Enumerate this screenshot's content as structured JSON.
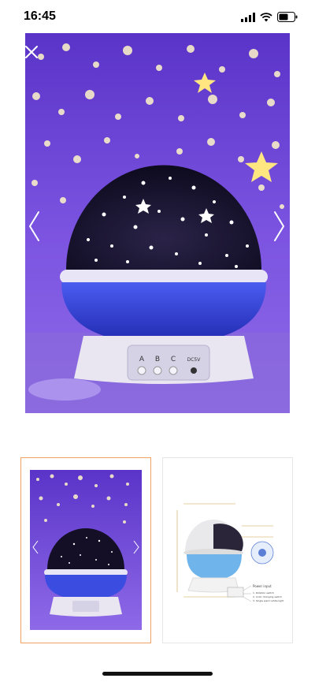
{
  "status_bar": {
    "time": "16:45",
    "icons": [
      "cellular-signal-icon",
      "wifi-icon",
      "battery-icon"
    ]
  },
  "viewer": {
    "close_icon": "close-icon",
    "prev_icon": "chevron-left-icon",
    "next_icon": "chevron-right-icon",
    "product_button_labels": [
      "A",
      "B",
      "C",
      "DC5V"
    ]
  },
  "thumbnails": [
    {
      "name": "starry-projector-photo",
      "selected": true
    },
    {
      "name": "projector-diagram",
      "selected": false,
      "annotations": [
        "Power input",
        "1. Rotation switch",
        "2. Color changing switch",
        "3. Single warm white light"
      ]
    }
  ],
  "colors": {
    "selected_border": "#f0a060",
    "thumb_border": "#e6e6e6",
    "lamp_blue": "#3b4de0",
    "background": "#ffffff"
  }
}
